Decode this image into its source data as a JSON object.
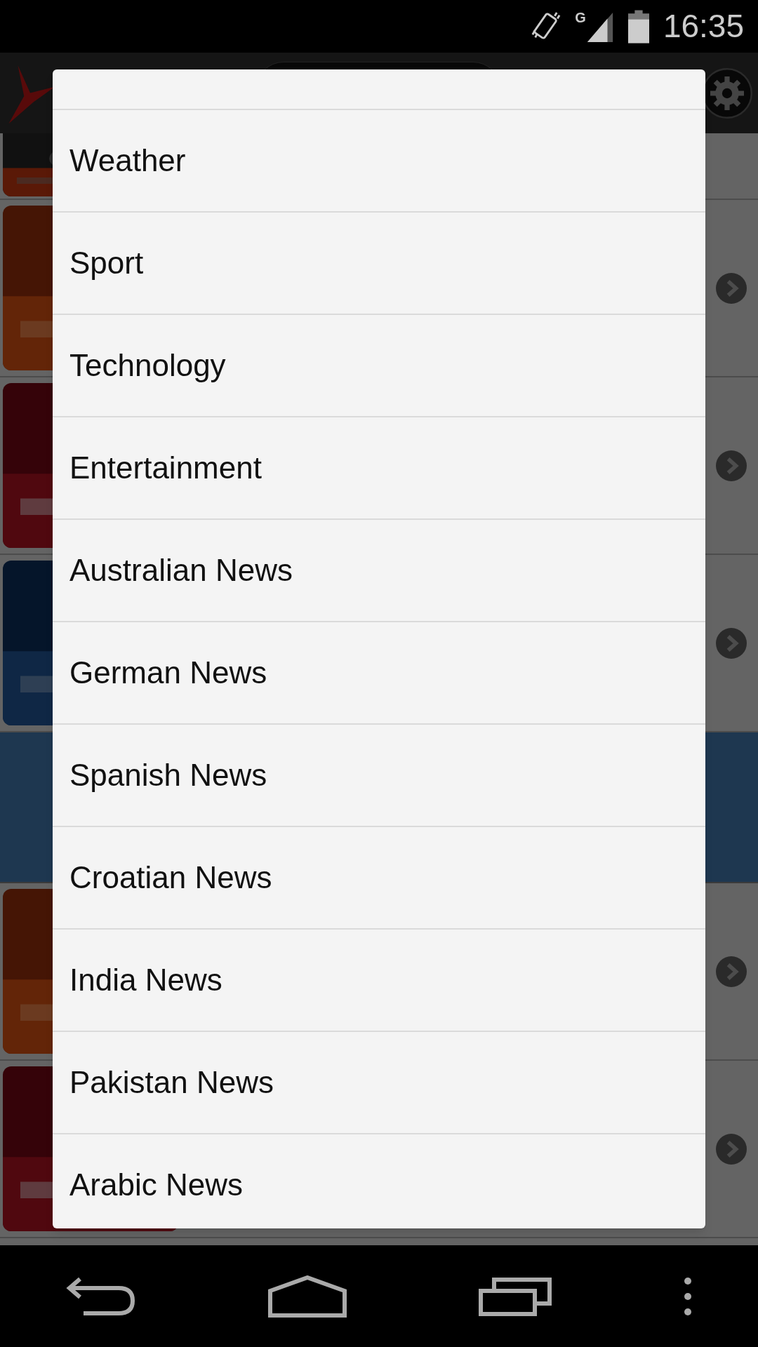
{
  "status_bar": {
    "network_label": "G",
    "time": "16:35"
  },
  "background_rows": [
    {
      "kind": "channel"
    },
    {
      "kind": "channel"
    },
    {
      "kind": "channel"
    },
    {
      "kind": "banner"
    },
    {
      "kind": "channel"
    },
    {
      "kind": "channel"
    }
  ],
  "menu": {
    "items": [
      "Weather",
      "Sport",
      "Technology",
      "Entertainment",
      "Australian News",
      "German News",
      "Spanish News",
      "Croatian News",
      "India News",
      "Pakistan News",
      "Arabic News"
    ]
  }
}
